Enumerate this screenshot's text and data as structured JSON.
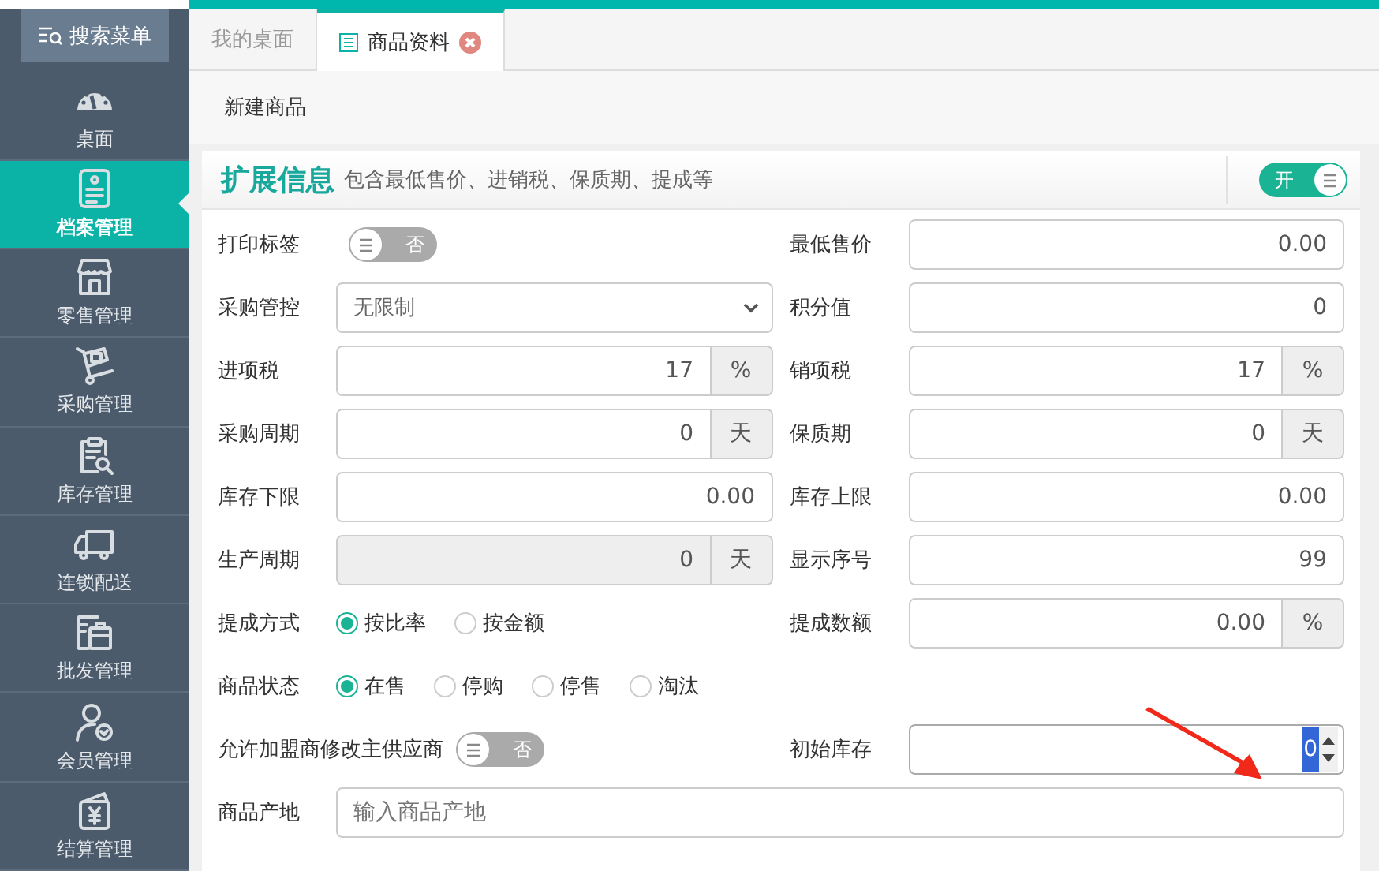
{
  "sidebar": {
    "search_button": "搜索菜单",
    "items": [
      {
        "label": "桌面",
        "selected": false
      },
      {
        "label": "档案管理",
        "selected": true
      },
      {
        "label": "零售管理",
        "selected": false
      },
      {
        "label": "采购管理",
        "selected": false
      },
      {
        "label": "库存管理",
        "selected": false
      },
      {
        "label": "连锁配送",
        "selected": false
      },
      {
        "label": "批发管理",
        "selected": false
      },
      {
        "label": "会员管理",
        "selected": false
      },
      {
        "label": "结算管理",
        "selected": false
      }
    ]
  },
  "tabs": [
    {
      "label": "我的桌面",
      "selected": false,
      "closable": false
    },
    {
      "label": "商品资料",
      "selected": true,
      "closable": true
    }
  ],
  "toolbar": {
    "buttons": [
      "新建商品"
    ]
  },
  "panel": {
    "title": "扩展信息",
    "subtitle": "包含最低售价、进销税、保质期、提成等",
    "toggle": {
      "label": "开",
      "on": true
    }
  },
  "rows": [
    {
      "cells": [
        {
          "kind": "toggle",
          "label": "打印标签",
          "toggle_label": "否",
          "on": false
        },
        {
          "kind": "input",
          "label": "最低售价",
          "value": "0.00"
        }
      ]
    },
    {
      "cells": [
        {
          "kind": "select",
          "label": "采购管控",
          "value": "无限制"
        },
        {
          "kind": "input",
          "label": "积分值",
          "value": "0"
        }
      ]
    },
    {
      "cells": [
        {
          "kind": "input",
          "label": "进项税",
          "value": "17",
          "unit": "%"
        },
        {
          "kind": "input",
          "label": "销项税",
          "value": "17",
          "unit": "%"
        }
      ]
    },
    {
      "cells": [
        {
          "kind": "input",
          "label": "采购周期",
          "value": "0",
          "unit": "天"
        },
        {
          "kind": "input",
          "label": "保质期",
          "value": "0",
          "unit": "天"
        }
      ]
    },
    {
      "cells": [
        {
          "kind": "input",
          "label": "库存下限",
          "value": "0.00"
        },
        {
          "kind": "input",
          "label": "库存上限",
          "value": "0.00"
        }
      ]
    },
    {
      "cells": [
        {
          "kind": "input",
          "label": "生产周期",
          "value": "0",
          "unit": "天",
          "disabled": true
        },
        {
          "kind": "input",
          "label": "显示序号",
          "value": "99"
        }
      ]
    },
    {
      "cells": [
        {
          "kind": "radio",
          "label": "提成方式",
          "options": [
            {
              "label": "按比率",
              "selected": true
            },
            {
              "label": "按金额",
              "selected": false
            }
          ]
        },
        {
          "kind": "input",
          "label": "提成数额",
          "value": "0.00",
          "unit": "%"
        }
      ]
    },
    {
      "cells": [
        {
          "kind": "radio",
          "label": "商品状态",
          "options": [
            {
              "label": "在售",
              "selected": true
            },
            {
              "label": "停购",
              "selected": false
            },
            {
              "label": "停售",
              "selected": false
            },
            {
              "label": "淘汰",
              "selected": false
            }
          ]
        }
      ]
    },
    {
      "cells": [
        {
          "kind": "toggle",
          "label": "允许加盟商修改主供应商",
          "toggle_label": "否",
          "on": false
        },
        {
          "kind": "number",
          "label": "初始库存",
          "value": "0",
          "text_selected": true
        }
      ]
    },
    {
      "cells": [
        {
          "kind": "text",
          "label": "商品产地",
          "placeholder": "输入商品产地"
        }
      ]
    }
  ]
}
